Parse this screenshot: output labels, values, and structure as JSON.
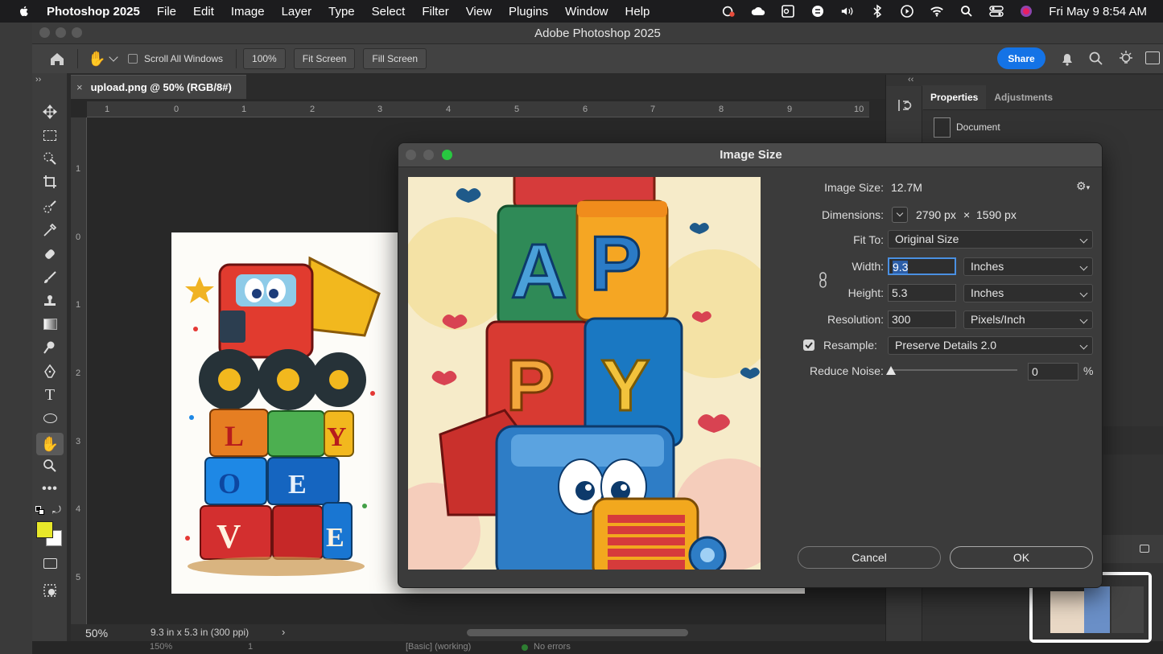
{
  "menubar": {
    "app": "Photoshop 2025",
    "items": [
      "File",
      "Edit",
      "Image",
      "Layer",
      "Type",
      "Select",
      "Filter",
      "View",
      "Plugins",
      "Window",
      "Help"
    ],
    "clock": "Fri May 9  8:54 AM"
  },
  "window": {
    "title": "Adobe Photoshop 2025"
  },
  "options": {
    "scroll_all": "Scroll All Windows",
    "zoom": "100%",
    "fit_screen": "Fit Screen",
    "fill_screen": "Fill Screen",
    "share": "Share"
  },
  "document": {
    "tab_title": "upload.png @ 50% (RGB/8#)",
    "ruler_top": [
      "1",
      "0",
      "1",
      "2",
      "3",
      "4",
      "5",
      "6",
      "7",
      "8",
      "9",
      "10"
    ],
    "ruler_left": [
      "1",
      "0",
      "1",
      "2",
      "3",
      "4",
      "5"
    ],
    "zoom": "50%",
    "doc_info": "9.3 in x 5.3 in (300 ppi)"
  },
  "bottom_bar": {
    "zoom": "150%",
    "page": "1",
    "layer_info": "[Basic] (working)",
    "errors": "No errors"
  },
  "panels": {
    "tab_properties": "Properties",
    "tab_adjustments": "Adjustments",
    "document_label": "Document"
  },
  "dialog": {
    "title": "Image Size",
    "image_size_label": "Image Size:",
    "image_size_value": "12.7M",
    "dimensions_label": "Dimensions:",
    "dim_width": "2790 px",
    "dim_x": "×",
    "dim_height": "1590 px",
    "fit_to_label": "Fit To:",
    "fit_to_value": "Original Size",
    "width_label": "Width:",
    "width_value": "9.3",
    "width_unit": "Inches",
    "height_label": "Height:",
    "height_value": "5.3",
    "height_unit": "Inches",
    "resolution_label": "Resolution:",
    "resolution_value": "300",
    "resolution_unit": "Pixels/Inch",
    "resample_label": "Resample:",
    "resample_value": "Preserve Details 2.0",
    "resample_checked": true,
    "noise_label": "Reduce Noise:",
    "noise_value": "0",
    "noise_unit": "%",
    "cancel": "Cancel",
    "ok": "OK"
  },
  "canvas_art": {
    "blocks_left": [
      "L",
      "Y",
      "O",
      "E",
      "V",
      "E"
    ],
    "blocks_preview": [
      "A",
      "P",
      "P",
      "Y"
    ]
  },
  "colors": {
    "accent": "#1473e6",
    "foreground_swatch": "#e8e82a",
    "background_swatch": "#ffffff"
  }
}
